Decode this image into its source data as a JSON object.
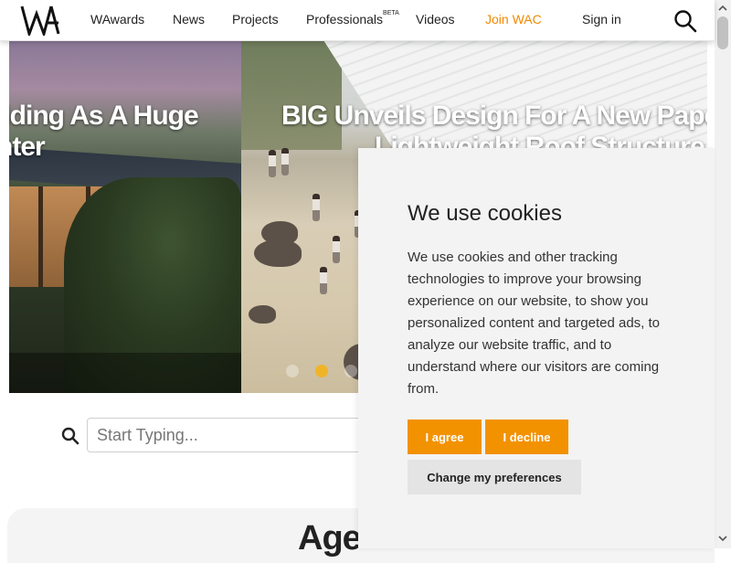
{
  "nav": {
    "items": [
      {
        "label": "WAwards"
      },
      {
        "label": "News"
      },
      {
        "label": "Projects"
      },
      {
        "label": "Professionals",
        "sup": "BETA"
      },
      {
        "label": "Videos"
      },
      {
        "label": "Join WAC"
      },
      {
        "label": "Sign in"
      }
    ],
    "accent_color": "#f08a00",
    "logo_icon": "wa-logo",
    "search_icon": "search-icon"
  },
  "hero": {
    "left_title_line1": "ilding As A Huge",
    "left_title_line2": "nter",
    "right_title_line1": "BIG Unveils Design For A New Paper Ar",
    "right_title_line2": "Lightweight Roof Structure In",
    "active_dot_color": "#f0b429"
  },
  "search": {
    "placeholder": "Start Typing..."
  },
  "lower": {
    "heading": "Age"
  },
  "cookie": {
    "title": "We use cookies",
    "body": "We use cookies and other tracking technologies to improve your browsing experience on our website, to show you personalized content and targeted ads, to analyze our website traffic, and to understand where our visitors are coming from.",
    "agree_label": "I agree",
    "decline_label": "I decline",
    "preferences_label": "Change my preferences",
    "button_color": "#f39200"
  }
}
